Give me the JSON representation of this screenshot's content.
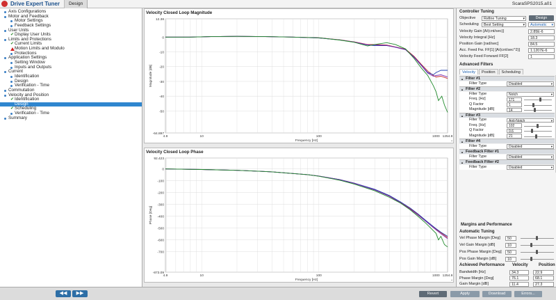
{
  "app": {
    "title": "Drive Expert Tuner",
    "tab": "Design",
    "file": "ScaraSPS2015.a01"
  },
  "nav": {
    "items": [
      {
        "label": "Axis Configurations",
        "level": 0,
        "mark": "dot"
      },
      {
        "label": "Motor and Feedback",
        "level": 0,
        "mark": "dot"
      },
      {
        "label": "Motor Settings",
        "level": 1,
        "mark": "dot"
      },
      {
        "label": "Feedback Settings",
        "level": 1,
        "mark": "dot"
      },
      {
        "label": "User Units",
        "level": 0,
        "mark": "dot"
      },
      {
        "label": "Display User Units",
        "level": 1,
        "mark": "check"
      },
      {
        "label": "Limits and Protections",
        "level": 0,
        "mark": "dot"
      },
      {
        "label": "Current Limits",
        "level": 1,
        "mark": "check"
      },
      {
        "label": "Motion Limits and Modulo",
        "level": 1,
        "mark": "warn"
      },
      {
        "label": "Protections",
        "level": 1,
        "mark": "dot"
      },
      {
        "label": "Application Settings",
        "level": 0,
        "mark": "dot"
      },
      {
        "label": "Setting Window",
        "level": 1,
        "mark": "dot"
      },
      {
        "label": "Inputs and Outputs",
        "level": 1,
        "mark": "dot"
      },
      {
        "label": "Current",
        "level": 0,
        "mark": "dot"
      },
      {
        "label": "Identification",
        "level": 1,
        "mark": "dot"
      },
      {
        "label": "Design",
        "level": 1,
        "mark": "dot"
      },
      {
        "label": "Verification - Time",
        "level": 1,
        "mark": "dot"
      },
      {
        "label": "Commutation",
        "level": 0,
        "mark": "dot"
      },
      {
        "label": "Velocity and Position",
        "level": 0,
        "mark": "dot"
      },
      {
        "label": "Identification",
        "level": 1,
        "mark": "check"
      },
      {
        "label": "Design",
        "level": 1,
        "mark": "none",
        "selected": true
      },
      {
        "label": "Scheduling",
        "level": 1,
        "mark": "check"
      },
      {
        "label": "Verification - Time",
        "level": 1,
        "mark": "dot"
      },
      {
        "label": "Summary",
        "level": 0,
        "mark": "dot"
      }
    ],
    "prev": "◀◀",
    "next": "▶▶"
  },
  "footer": {
    "revert": "Revert",
    "apply": "Apply",
    "download": "Download",
    "errors": "Errors..."
  },
  "colors": {
    "red": "#c62828",
    "blue": "#1f3fb0",
    "purple": "#7a2ab0",
    "green": "#1f8a2a"
  },
  "chart_data": [
    {
      "type": "line",
      "title": "Velocity Closed Loop Magnitude",
      "xlabel": "Frequency [Hz]",
      "ylabel": "Magnitude [dB]",
      "xscale": "log",
      "xlim": [
        4.9,
        1254.9
      ],
      "ylim": [
        -64.897,
        12.38
      ],
      "x_ticks": [
        "4.9",
        "10",
        "100",
        "1000",
        "1254.9"
      ],
      "y_ticks": [
        "12.38",
        "0",
        "-10",
        "-20",
        "-30",
        "-40",
        "-50",
        "-64.897"
      ],
      "grid": true,
      "series": [
        {
          "x": [
            4.9,
            8,
            12,
            20,
            35,
            60,
            100,
            150,
            200,
            260,
            300,
            380,
            450,
            550,
            650,
            750,
            850,
            950,
            1000,
            1100,
            1254.9
          ],
          "y": [
            0,
            0,
            0.3,
            0.5,
            0.3,
            0,
            -0.5,
            -1.8,
            -3.2,
            -5,
            -5,
            -5.4,
            -6.7,
            -8.2,
            -13,
            -18.5,
            -23,
            -26,
            -27,
            -26.5,
            -28
          ]
        },
        {
          "x": [
            4.9,
            8,
            12,
            20,
            35,
            60,
            100,
            150,
            200,
            260,
            300,
            380,
            450,
            550,
            650,
            750,
            850,
            950,
            1000,
            1100,
            1254.9
          ],
          "y": [
            0,
            0,
            0.3,
            0.5,
            0.3,
            0,
            -0.6,
            -1.9,
            -3.4,
            -5.4,
            -5.8,
            -5.8,
            -6.8,
            -8.5,
            -13.5,
            -19,
            -24,
            -25.5,
            -24,
            -22.5,
            -22.5
          ]
        },
        {
          "x": [
            4.9,
            8,
            12,
            20,
            35,
            60,
            100,
            150,
            200,
            260,
            300,
            380,
            450,
            550,
            650,
            750,
            850,
            950,
            1000,
            1100,
            1254.9
          ],
          "y": [
            0,
            0,
            0.3,
            0.5,
            0.3,
            0,
            -0.6,
            -1.9,
            -3.3,
            -5.2,
            -5.4,
            -5.6,
            -6.9,
            -8.6,
            -13.8,
            -19.3,
            -24.4,
            -26.5,
            -26,
            -25.5,
            -27
          ]
        },
        {
          "x": [
            4.9,
            8,
            12,
            20,
            35,
            60,
            100,
            150,
            200,
            260,
            300,
            380,
            450,
            550,
            650,
            750,
            850,
            950,
            1000,
            1050,
            1120,
            1180,
            1254.9
          ],
          "y": [
            0,
            0,
            0.3,
            0.5,
            0.3,
            0,
            -0.5,
            -2,
            -3.5,
            -6,
            -5,
            -3.8,
            -5,
            -8,
            -14.5,
            -21,
            -26,
            -33,
            -37,
            -43,
            -40,
            -46,
            -51
          ]
        }
      ]
    },
    {
      "type": "line",
      "title": "Velocity Closed Loop Phase",
      "xlabel": "Frequency [Hz]",
      "ylabel": "Phase [Deg]",
      "xscale": "log",
      "xlim": [
        4.9,
        1254.9
      ],
      "ylim": [
        -873.09,
        92.423
      ],
      "x_ticks": [
        "4.9",
        "10",
        "100",
        "1000",
        "1254.9"
      ],
      "y_ticks": [
        "92.423",
        "0",
        "-100",
        "-200",
        "-300",
        "-400",
        "-500",
        "-600",
        "-700",
        "-873.09"
      ],
      "grid": true,
      "series": [
        {
          "x": [
            4.9,
            10,
            20,
            40,
            80,
            100,
            150,
            200,
            300,
            400,
            500,
            600,
            700,
            800,
            900,
            1000,
            1100,
            1254.9
          ],
          "y": [
            0,
            -5,
            -12,
            -25,
            -48,
            -60,
            -90,
            -120,
            -175,
            -230,
            -285,
            -335,
            -385,
            -430,
            -470,
            -510,
            -540,
            -580
          ]
        },
        {
          "x": [
            4.9,
            10,
            20,
            40,
            80,
            100,
            150,
            200,
            300,
            400,
            500,
            600,
            700,
            800,
            900,
            1000,
            1100,
            1254.9
          ],
          "y": [
            0,
            -5,
            -12,
            -25,
            -48,
            -60,
            -90,
            -120,
            -172,
            -225,
            -280,
            -330,
            -380,
            -428,
            -470,
            -505,
            -535,
            -570
          ]
        },
        {
          "x": [
            4.9,
            10,
            20,
            40,
            80,
            100,
            150,
            200,
            300,
            400,
            500,
            600,
            700,
            800,
            900,
            1000,
            1100,
            1254.9
          ],
          "y": [
            0,
            -5,
            -12,
            -25,
            -48,
            -60,
            -92,
            -122,
            -178,
            -232,
            -288,
            -340,
            -390,
            -435,
            -478,
            -515,
            -548,
            -590
          ]
        },
        {
          "x": [
            4.9,
            10,
            20,
            40,
            80,
            100,
            150,
            200,
            300,
            400,
            500,
            600,
            700,
            800,
            900,
            1000,
            1050,
            1100,
            1180,
            1254.9
          ],
          "y": [
            0,
            -5,
            -12,
            -25,
            -48,
            -62,
            -95,
            -128,
            -185,
            -240,
            -290,
            -345,
            -400,
            -450,
            -500,
            -545,
            -600,
            -570,
            -640,
            -660
          ]
        }
      ]
    }
  ],
  "right": {
    "controller_tuning": "Controller Tuning",
    "objective_label": "Objective",
    "objective_value": "Refine Tuning",
    "design_btn": "Design",
    "scheduling_label": "Scheduling",
    "scheduling_value": "Best Setting",
    "scheduling_mode": "Automatic",
    "params": [
      {
        "label": "Velocity Gain [A/(cnt/sec)]",
        "value": "2.85E-6"
      },
      {
        "label": "Velocity Integral [Hz]",
        "value": "18.3"
      },
      {
        "label": "Position Gain [rad/sec]",
        "value": "84.5"
      },
      {
        "label": "Acc. Feed Fw. FF[1] [A/(cnt/sec^2)]",
        "value": "1.1207E-6"
      },
      {
        "label": "Velocity Feed Forward FF[2]",
        "value": "1"
      }
    ],
    "advanced_filters": "Advanced Filters",
    "subtabs": [
      "Velocity",
      "Position",
      "Scheduling"
    ],
    "filters": [
      {
        "head": "Filter #1",
        "rows": [
          {
            "label": "Filter Type",
            "select": "Disabled"
          }
        ]
      },
      {
        "head": "Filter #2",
        "rows": [
          {
            "label": "Filter Type",
            "select": "Notch"
          },
          {
            "label": "Freq. [Hz]",
            "value": "171",
            "slider": 0.55
          },
          {
            "label": "Q Factor",
            "value": "1",
            "slider": 0.3
          },
          {
            "label": "Magnitude [dB]",
            "value": "14",
            "slider": 0.35
          }
        ]
      },
      {
        "head": "Filter #3",
        "rows": [
          {
            "label": "Filter Type",
            "select": "Anti-Notch"
          },
          {
            "label": "Freq. [Hz]",
            "value": "102",
            "slider": 0.45
          },
          {
            "label": "Q Factor",
            "value": "0.6",
            "slider": 0.25
          },
          {
            "label": "Magnitude [dB]",
            "value": "21",
            "slider": 0.4
          }
        ]
      },
      {
        "head": "Filter #4",
        "rows": [
          {
            "label": "Filter Type",
            "select": "Disabled"
          }
        ]
      },
      {
        "head": "Feedback Filter #1",
        "rows": [
          {
            "label": "Filter Type",
            "select": "Disabled"
          }
        ]
      },
      {
        "head": "Feedback Filter #2",
        "rows": [
          {
            "label": "Filter Type",
            "select": "Disabled"
          }
        ]
      }
    ],
    "margins_title": "Margins and Performance",
    "auto_tuning": "Automatic Tuning",
    "margins": [
      {
        "label": "Vel Phase Margin [Deg]",
        "value": "50",
        "slider": 0.45
      },
      {
        "label": "Vel Gain Margin [dB]",
        "value": "10",
        "slider": 0.3
      },
      {
        "label": "Pos Phase Margin [Deg]",
        "value": "50",
        "slider": 0.45
      },
      {
        "label": "Pos Gain Margin [dB]",
        "value": "10",
        "slider": 0.3
      }
    ],
    "achieved": "Achieved Performance",
    "col_velocity": "Velocity",
    "col_position": "Position",
    "perf": [
      {
        "label": "Bandwidth [Hz]",
        "velocity": "34.3",
        "position": "22.9"
      },
      {
        "label": "Phase Margin [Deg]",
        "velocity": "76.1",
        "position": "68.1"
      },
      {
        "label": "Gain Margin [dB]",
        "velocity": "11.4",
        "position": "27.3"
      }
    ]
  }
}
